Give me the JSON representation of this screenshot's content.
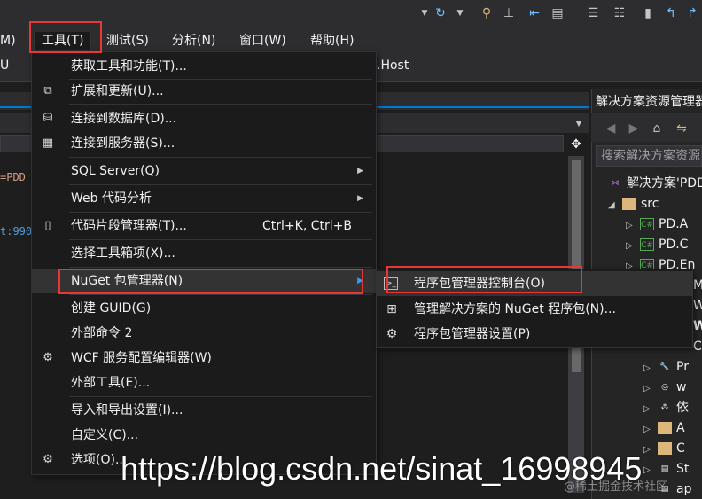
{
  "menubar": {
    "items": [
      {
        "label": "M)"
      },
      {
        "label": "工具(T)"
      },
      {
        "label": "测试(S)"
      },
      {
        "label": "分析(N)"
      },
      {
        "label": "窗口(W)"
      },
      {
        "label": "帮助(H)"
      }
    ]
  },
  "toolbar": {
    "left_text": "U",
    "host_text": ".Host"
  },
  "editor": {
    "code_line1": "=PDD",
    "code_line2": "t:990"
  },
  "tools_menu": {
    "items": [
      {
        "label": "获取工具和功能(T)..."
      },
      {
        "label": "扩展和更新(U)..."
      },
      {
        "label": "连接到数据库(D)..."
      },
      {
        "label": "连接到服务器(S)..."
      },
      {
        "label": "SQL Server(Q)"
      },
      {
        "label": "Web 代码分析"
      },
      {
        "label": "代码片段管理器(T)...",
        "shortcut": "Ctrl+K, Ctrl+B"
      },
      {
        "label": "选择工具箱项(X)..."
      },
      {
        "label": "NuGet 包管理器(N)"
      },
      {
        "label": "创建 GUID(G)"
      },
      {
        "label": "外部命令 2"
      },
      {
        "label": "WCF 服务配置编辑器(W)"
      },
      {
        "label": "外部工具(E)..."
      },
      {
        "label": "导入和导出设置(I)..."
      },
      {
        "label": "自定义(C)..."
      },
      {
        "label": "选项(O)..."
      }
    ]
  },
  "nuget_submenu": {
    "items": [
      {
        "label": "程序包管理器控制台(O)"
      },
      {
        "label": "管理解决方案的 NuGet 程序包(N)..."
      },
      {
        "label": "程序包管理器设置(P)"
      }
    ]
  },
  "solution_explorer": {
    "title": "解决方案资源管理器",
    "search_placeholder": "搜索解决方案资源管理器",
    "tree": [
      {
        "label": "解决方案'PDD"
      },
      {
        "label": "src"
      },
      {
        "label": "PD.A"
      },
      {
        "label": "PD.C"
      },
      {
        "label": "PD.En"
      },
      {
        "label": "M"
      },
      {
        "label": "W"
      },
      {
        "label": "W"
      },
      {
        "label": "C"
      },
      {
        "label": "Pr"
      },
      {
        "label": "w"
      },
      {
        "label": "依"
      },
      {
        "label": "A"
      },
      {
        "label": "C"
      },
      {
        "label": "St"
      },
      {
        "label": "ap"
      }
    ]
  },
  "watermark": {
    "url": "https://blog.csdn.net/sinat_16998945",
    "badge": "@稀土掘金技术社区"
  }
}
